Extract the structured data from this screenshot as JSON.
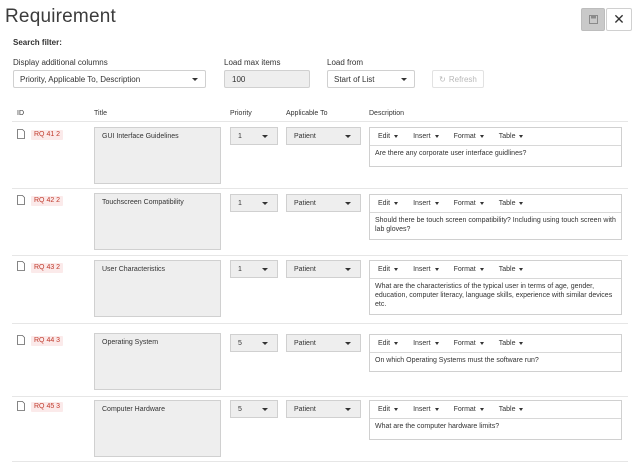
{
  "page": {
    "title": "Requirement",
    "search_filter_label": "Search filter:"
  },
  "filters": {
    "columns_label": "Display additional columns",
    "columns_value": "Priority, Applicable To, Description",
    "max_label": "Load max items",
    "max_value": "100",
    "from_label": "Load from",
    "from_value": "Start of List",
    "refresh_label": "Refresh"
  },
  "table": {
    "headers": {
      "id": "ID",
      "title": "Title",
      "priority": "Priority",
      "applicable": "Applicable To",
      "description": "Description"
    },
    "toolbar": {
      "edit": "Edit",
      "insert": "Insert",
      "format": "Format",
      "table": "Table"
    },
    "rows": [
      {
        "id": "RQ 41 2",
        "title": "GUI Interface Guidelines",
        "priority": "1",
        "applicable": "Patient",
        "description": "Are there any corporate user interface guidlines?"
      },
      {
        "id": "RQ 42 2",
        "title": "Touchscreen Compatibility",
        "priority": "1",
        "applicable": "Patient",
        "description": "Should there be touch screen compatibility? Including using touch screen with lab gloves?"
      },
      {
        "id": "RQ 43 2",
        "title": "User Characteristics",
        "priority": "1",
        "applicable": "Patient",
        "description": "What are the characteristics of the typical user in terms of age, gender, education, computer literacy, language skills, experience with similar devices etc."
      },
      {
        "id": "RQ 44 3",
        "title": "Operating System",
        "priority": "5",
        "applicable": "Patient",
        "description": "On which Operating Systems must the software run?"
      },
      {
        "id": "RQ 45 3",
        "title": "Computer Hardware",
        "priority": "5",
        "applicable": "Patient",
        "description": "What are the computer hardware limits?"
      }
    ]
  },
  "colors": {
    "id_badge_text": "#c0392b",
    "id_badge_bg": "#fbeaea",
    "disabled_button": "#c9c9c9"
  }
}
